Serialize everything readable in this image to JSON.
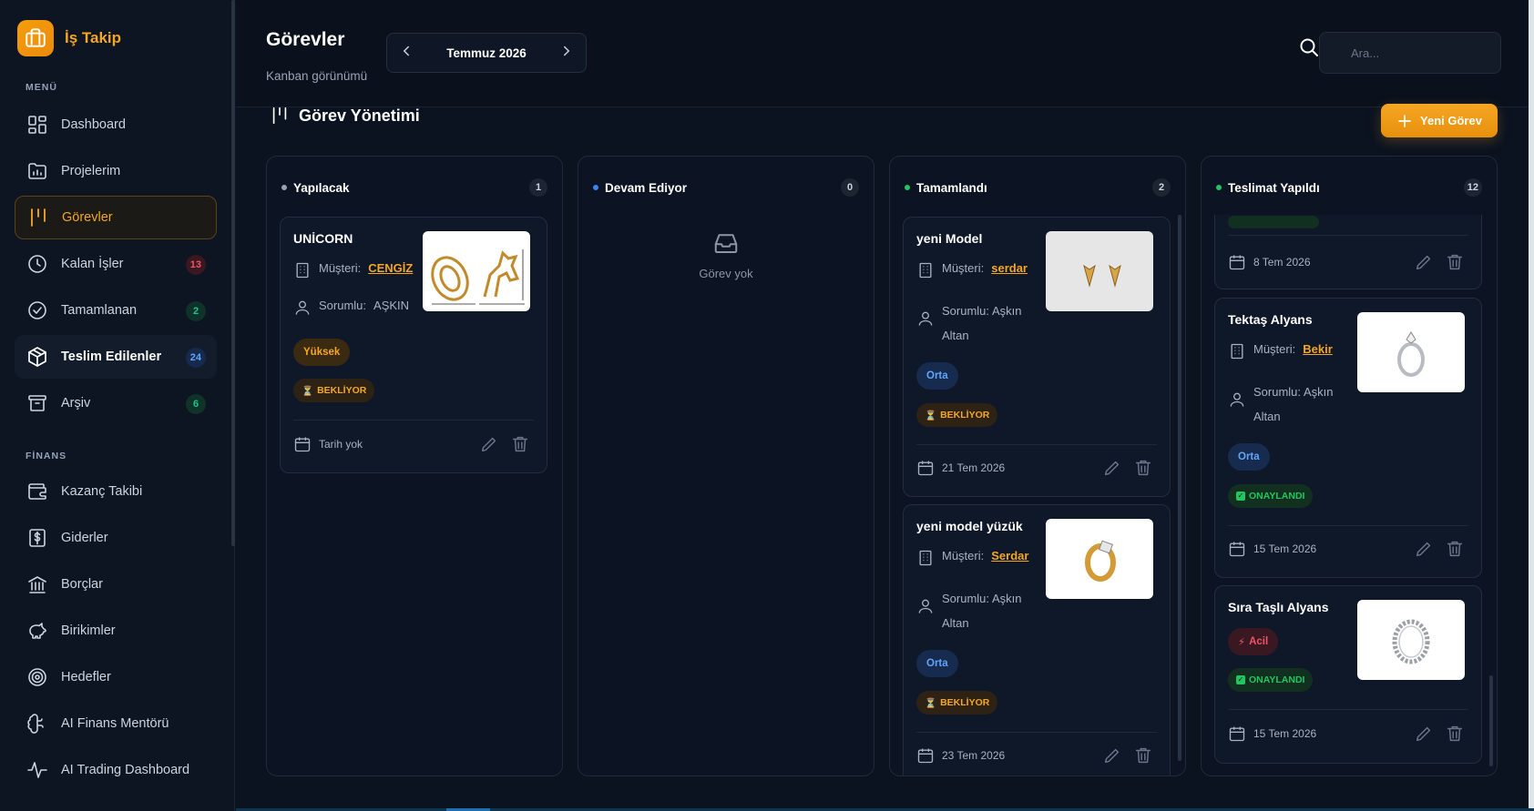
{
  "app": {
    "name": "İş Takip"
  },
  "sidebar": {
    "menu_label": "MENÜ",
    "finance_label": "FİNANS",
    "menu": [
      {
        "label": "Dashboard",
        "icon": "dashboard-icon",
        "badge": ""
      },
      {
        "label": "Projelerim",
        "icon": "folder-chart-icon",
        "badge": ""
      },
      {
        "label": "Görevler",
        "icon": "kanban-icon",
        "badge": ""
      },
      {
        "label": "Kalan İşler",
        "icon": "clock-icon",
        "badge": "13"
      },
      {
        "label": "Tamamlanan",
        "icon": "check-circle-icon",
        "badge": "2"
      },
      {
        "label": "Teslim Edilenler",
        "icon": "package-icon",
        "badge": "24"
      },
      {
        "label": "Arşiv",
        "icon": "archive-icon",
        "badge": "6"
      }
    ],
    "finance": [
      {
        "label": "Kazanç Takibi",
        "icon": "wallet-icon"
      },
      {
        "label": "Giderler",
        "icon": "receipt-icon"
      },
      {
        "label": "Borçlar",
        "icon": "bank-icon"
      },
      {
        "label": "Birikimler",
        "icon": "piggy-bank-icon"
      },
      {
        "label": "Hedefler",
        "icon": "target-icon"
      },
      {
        "label": "AI Finans Mentörü",
        "icon": "brain-icon"
      },
      {
        "label": "AI Trading Dashboard",
        "icon": "activity-icon"
      }
    ]
  },
  "header": {
    "title": "Görevler",
    "subtitle": "Kanban görünümü",
    "month": "Temmuz 2026",
    "search_placeholder": "Ara..."
  },
  "board": {
    "title": "Görev Yönetimi",
    "new_button": "Yeni Görev"
  },
  "labels": {
    "customer": "Müşteri:",
    "responsible": "Sorumlu:",
    "empty": "Görev yok"
  },
  "columns": [
    {
      "name": "Yapılacak",
      "count": "1",
      "dot": "#9ca3af"
    },
    {
      "name": "Devam Ediyor",
      "count": "0",
      "dot": "#3b82f6"
    },
    {
      "name": "Tamamlandı",
      "count": "2",
      "dot": "#22c55e"
    },
    {
      "name": "Teslimat Yapıldı",
      "count": "12",
      "dot": "#22c55e"
    }
  ],
  "cards": {
    "unicorn": {
      "title": "UNİCORN",
      "customer": "CENGİZ",
      "responsible": "AŞKIN",
      "priority": "Yüksek",
      "status": "BEKLİYOR",
      "date": "Tarih yok"
    },
    "yeni_model": {
      "title": "yeni Model",
      "customer": "serdar",
      "responsible": "Aşkın Altan",
      "priority": "Orta",
      "status": "BEKLİYOR",
      "date": "21 Tem 2026"
    },
    "yeni_model_yuzuk": {
      "title": "yeni model yüzük",
      "customer": "Serdar",
      "responsible": "Aşkın Altan",
      "priority": "Orta",
      "status": "BEKLİYOR",
      "date": "23 Tem 2026"
    },
    "partial": {
      "date": "8 Tem 2026"
    },
    "tektas": {
      "title": "Tektaş Alyans",
      "customer": "Bekir",
      "responsible": "Aşkın Altan",
      "priority": "Orta",
      "status": "ONAYLANDI",
      "date": "15 Tem 2026"
    },
    "sira_tasli": {
      "title": "Sıra Taşlı Alyans",
      "priority": "Acil",
      "status": "ONAYLANDI",
      "date": "15 Tem 2026"
    }
  },
  "colors": {
    "accent": "#f5a623",
    "bg": "#0b1220",
    "danger": "#f05267",
    "success": "#22c55e",
    "info": "#60a5fa"
  }
}
